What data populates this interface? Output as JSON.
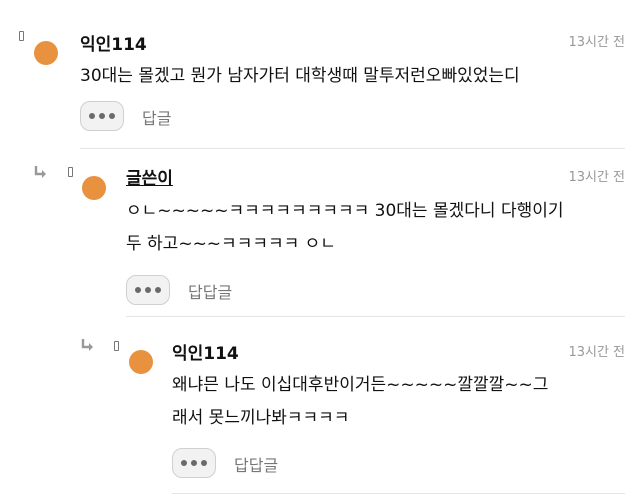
{
  "comments": [
    {
      "author": "익인114",
      "time": "13시간 전",
      "lines": [
        "30대는 몰겠고 뭔가 남자가터 대학생때 말투저런오빠있었는디"
      ],
      "reply_label": "답글"
    },
    {
      "author": "글쓴이",
      "time": "13시간 전",
      "lines": [
        "ㅇㄴ~~~~~ㅋㅋㅋㅋㅋㅋㅋㅋㅋ 30대는 몰겠다니 다행이기",
        "두 하고~~~ㅋㅋㅋㅋㅋ ㅇㄴ"
      ],
      "reply_label": "답답글"
    },
    {
      "author": "익인114",
      "time": "13시간 전",
      "lines": [
        "왜냐믄 나도 이십대후반이거든~~~~~깔깔깔~~그",
        "래서 못느끼나봐ㅋㅋㅋㅋ"
      ],
      "reply_label": "답답글"
    }
  ],
  "icons": {
    "more": "more-dots-icon",
    "reply": "reply-arrow-icon",
    "marker": "bookmark-marker-icon",
    "avatar": "avatar"
  },
  "colors": {
    "avatar": "#e8913e",
    "time": "#999999",
    "muted": "#777777"
  }
}
